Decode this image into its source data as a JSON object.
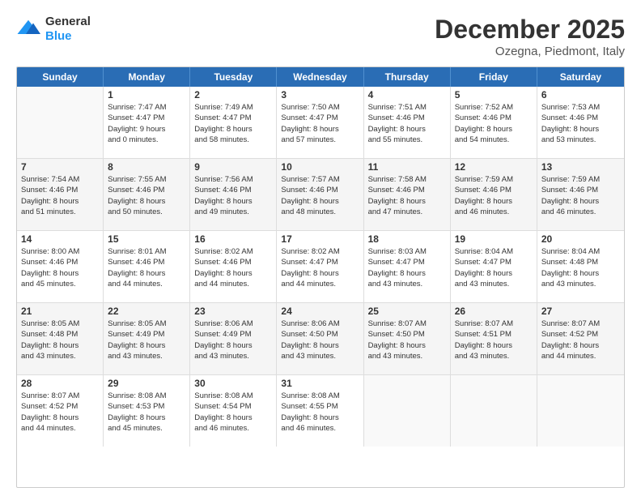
{
  "logo": {
    "general": "General",
    "blue": "Blue"
  },
  "title": "December 2025",
  "subtitle": "Ozegna, Piedmont, Italy",
  "header_days": [
    "Sunday",
    "Monday",
    "Tuesday",
    "Wednesday",
    "Thursday",
    "Friday",
    "Saturday"
  ],
  "rows": [
    [
      {
        "day": "",
        "lines": []
      },
      {
        "day": "1",
        "lines": [
          "Sunrise: 7:47 AM",
          "Sunset: 4:47 PM",
          "Daylight: 9 hours",
          "and 0 minutes."
        ]
      },
      {
        "day": "2",
        "lines": [
          "Sunrise: 7:49 AM",
          "Sunset: 4:47 PM",
          "Daylight: 8 hours",
          "and 58 minutes."
        ]
      },
      {
        "day": "3",
        "lines": [
          "Sunrise: 7:50 AM",
          "Sunset: 4:47 PM",
          "Daylight: 8 hours",
          "and 57 minutes."
        ]
      },
      {
        "day": "4",
        "lines": [
          "Sunrise: 7:51 AM",
          "Sunset: 4:46 PM",
          "Daylight: 8 hours",
          "and 55 minutes."
        ]
      },
      {
        "day": "5",
        "lines": [
          "Sunrise: 7:52 AM",
          "Sunset: 4:46 PM",
          "Daylight: 8 hours",
          "and 54 minutes."
        ]
      },
      {
        "day": "6",
        "lines": [
          "Sunrise: 7:53 AM",
          "Sunset: 4:46 PM",
          "Daylight: 8 hours",
          "and 53 minutes."
        ]
      }
    ],
    [
      {
        "day": "7",
        "lines": [
          "Sunrise: 7:54 AM",
          "Sunset: 4:46 PM",
          "Daylight: 8 hours",
          "and 51 minutes."
        ]
      },
      {
        "day": "8",
        "lines": [
          "Sunrise: 7:55 AM",
          "Sunset: 4:46 PM",
          "Daylight: 8 hours",
          "and 50 minutes."
        ]
      },
      {
        "day": "9",
        "lines": [
          "Sunrise: 7:56 AM",
          "Sunset: 4:46 PM",
          "Daylight: 8 hours",
          "and 49 minutes."
        ]
      },
      {
        "day": "10",
        "lines": [
          "Sunrise: 7:57 AM",
          "Sunset: 4:46 PM",
          "Daylight: 8 hours",
          "and 48 minutes."
        ]
      },
      {
        "day": "11",
        "lines": [
          "Sunrise: 7:58 AM",
          "Sunset: 4:46 PM",
          "Daylight: 8 hours",
          "and 47 minutes."
        ]
      },
      {
        "day": "12",
        "lines": [
          "Sunrise: 7:59 AM",
          "Sunset: 4:46 PM",
          "Daylight: 8 hours",
          "and 46 minutes."
        ]
      },
      {
        "day": "13",
        "lines": [
          "Sunrise: 7:59 AM",
          "Sunset: 4:46 PM",
          "Daylight: 8 hours",
          "and 46 minutes."
        ]
      }
    ],
    [
      {
        "day": "14",
        "lines": [
          "Sunrise: 8:00 AM",
          "Sunset: 4:46 PM",
          "Daylight: 8 hours",
          "and 45 minutes."
        ]
      },
      {
        "day": "15",
        "lines": [
          "Sunrise: 8:01 AM",
          "Sunset: 4:46 PM",
          "Daylight: 8 hours",
          "and 44 minutes."
        ]
      },
      {
        "day": "16",
        "lines": [
          "Sunrise: 8:02 AM",
          "Sunset: 4:46 PM",
          "Daylight: 8 hours",
          "and 44 minutes."
        ]
      },
      {
        "day": "17",
        "lines": [
          "Sunrise: 8:02 AM",
          "Sunset: 4:47 PM",
          "Daylight: 8 hours",
          "and 44 minutes."
        ]
      },
      {
        "day": "18",
        "lines": [
          "Sunrise: 8:03 AM",
          "Sunset: 4:47 PM",
          "Daylight: 8 hours",
          "and 43 minutes."
        ]
      },
      {
        "day": "19",
        "lines": [
          "Sunrise: 8:04 AM",
          "Sunset: 4:47 PM",
          "Daylight: 8 hours",
          "and 43 minutes."
        ]
      },
      {
        "day": "20",
        "lines": [
          "Sunrise: 8:04 AM",
          "Sunset: 4:48 PM",
          "Daylight: 8 hours",
          "and 43 minutes."
        ]
      }
    ],
    [
      {
        "day": "21",
        "lines": [
          "Sunrise: 8:05 AM",
          "Sunset: 4:48 PM",
          "Daylight: 8 hours",
          "and 43 minutes."
        ]
      },
      {
        "day": "22",
        "lines": [
          "Sunrise: 8:05 AM",
          "Sunset: 4:49 PM",
          "Daylight: 8 hours",
          "and 43 minutes."
        ]
      },
      {
        "day": "23",
        "lines": [
          "Sunrise: 8:06 AM",
          "Sunset: 4:49 PM",
          "Daylight: 8 hours",
          "and 43 minutes."
        ]
      },
      {
        "day": "24",
        "lines": [
          "Sunrise: 8:06 AM",
          "Sunset: 4:50 PM",
          "Daylight: 8 hours",
          "and 43 minutes."
        ]
      },
      {
        "day": "25",
        "lines": [
          "Sunrise: 8:07 AM",
          "Sunset: 4:50 PM",
          "Daylight: 8 hours",
          "and 43 minutes."
        ]
      },
      {
        "day": "26",
        "lines": [
          "Sunrise: 8:07 AM",
          "Sunset: 4:51 PM",
          "Daylight: 8 hours",
          "and 43 minutes."
        ]
      },
      {
        "day": "27",
        "lines": [
          "Sunrise: 8:07 AM",
          "Sunset: 4:52 PM",
          "Daylight: 8 hours",
          "and 44 minutes."
        ]
      }
    ],
    [
      {
        "day": "28",
        "lines": [
          "Sunrise: 8:07 AM",
          "Sunset: 4:52 PM",
          "Daylight: 8 hours",
          "and 44 minutes."
        ]
      },
      {
        "day": "29",
        "lines": [
          "Sunrise: 8:08 AM",
          "Sunset: 4:53 PM",
          "Daylight: 8 hours",
          "and 45 minutes."
        ]
      },
      {
        "day": "30",
        "lines": [
          "Sunrise: 8:08 AM",
          "Sunset: 4:54 PM",
          "Daylight: 8 hours",
          "and 46 minutes."
        ]
      },
      {
        "day": "31",
        "lines": [
          "Sunrise: 8:08 AM",
          "Sunset: 4:55 PM",
          "Daylight: 8 hours",
          "and 46 minutes."
        ]
      },
      {
        "day": "",
        "lines": []
      },
      {
        "day": "",
        "lines": []
      },
      {
        "day": "",
        "lines": []
      }
    ]
  ]
}
